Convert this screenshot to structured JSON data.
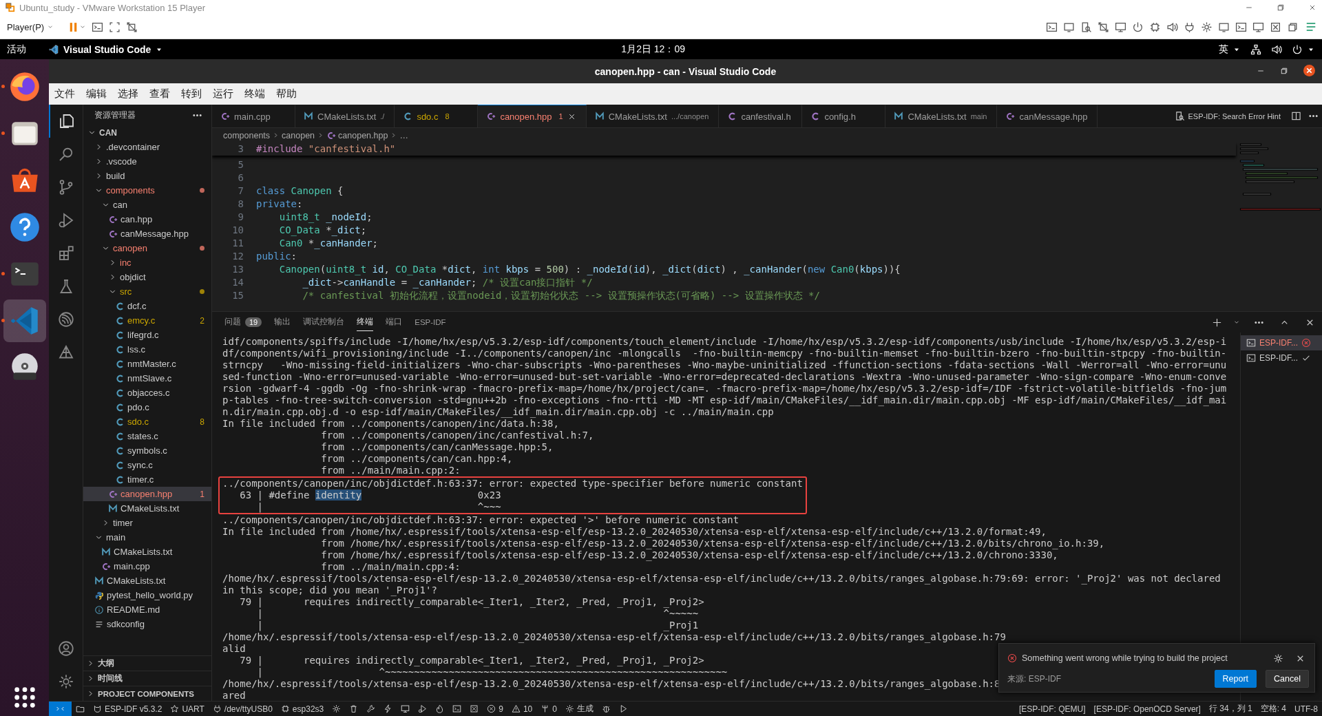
{
  "vm": {
    "title": "Ubuntu_study - VMware Workstation 15 Player",
    "player_menu": "Player(P)"
  },
  "topbar": {
    "activities": "活动",
    "app_menu": "Visual Studio Code",
    "clock": "1月2日  12：09",
    "input_method": "英"
  },
  "dock": [
    {
      "kind": "firefox",
      "running": true,
      "selected": false
    },
    {
      "kind": "files",
      "running": true,
      "selected": false
    },
    {
      "kind": "appstore",
      "running": false,
      "selected": false
    },
    {
      "kind": "help",
      "running": false,
      "selected": false
    },
    {
      "kind": "terminal",
      "running": true,
      "selected": false
    },
    {
      "kind": "vscode",
      "running": true,
      "selected": true
    },
    {
      "kind": "dvd",
      "running": false,
      "selected": false
    }
  ],
  "vscode": {
    "title": "canopen.hpp - can - Visual Studio Code",
    "menu": [
      "文件",
      "编辑",
      "选择",
      "查看",
      "转到",
      "运行",
      "终端",
      "帮助"
    ]
  },
  "activity_bar": [
    {
      "kind": "files",
      "selected": true
    },
    {
      "kind": "search",
      "selected": false
    },
    {
      "kind": "branch",
      "selected": false
    },
    {
      "kind": "debug",
      "selected": false
    },
    {
      "kind": "extensions",
      "selected": false
    },
    {
      "kind": "flask",
      "selected": false
    },
    {
      "kind": "esp",
      "selected": false
    },
    {
      "kind": "idf",
      "selected": false
    }
  ],
  "explorer": {
    "title": "资源管理器",
    "tree": [
      {
        "label": "CAN",
        "kind": "root",
        "expanded": true,
        "children": [
          {
            "label": ".devcontainer",
            "kind": "folder",
            "expanded": false
          },
          {
            "label": ".vscode",
            "kind": "folder",
            "expanded": false
          },
          {
            "label": "build",
            "kind": "folder",
            "expanded": false
          },
          {
            "label": "components",
            "kind": "folder",
            "expanded": true,
            "error": true,
            "children": [
              {
                "label": "can",
                "kind": "folder",
                "expanded": true,
                "children": [
                  {
                    "label": "can.hpp",
                    "kind": "cpp"
                  },
                  {
                    "label": "canMessage.hpp",
                    "kind": "cpp"
                  }
                ]
              },
              {
                "label": "canopen",
                "kind": "folder",
                "expanded": true,
                "error": true,
                "children": [
                  {
                    "label": "inc",
                    "kind": "folder",
                    "expanded": false,
                    "error": true
                  },
                  {
                    "label": "objdict",
                    "kind": "folder",
                    "expanded": false
                  },
                  {
                    "label": "src",
                    "kind": "folder",
                    "expanded": true,
                    "warning": true,
                    "children": [
                      {
                        "label": "dcf.c",
                        "kind": "c"
                      },
                      {
                        "label": "emcy.c",
                        "kind": "c",
                        "warning": true,
                        "badge": "2"
                      },
                      {
                        "label": "lifegrd.c",
                        "kind": "c"
                      },
                      {
                        "label": "lss.c",
                        "kind": "c"
                      },
                      {
                        "label": "nmtMaster.c",
                        "kind": "c"
                      },
                      {
                        "label": "nmtSlave.c",
                        "kind": "c"
                      },
                      {
                        "label": "objacces.c",
                        "kind": "c"
                      },
                      {
                        "label": "pdo.c",
                        "kind": "c"
                      },
                      {
                        "label": "sdo.c",
                        "kind": "c",
                        "warning": true,
                        "badge": "8"
                      },
                      {
                        "label": "states.c",
                        "kind": "c"
                      },
                      {
                        "label": "symbols.c",
                        "kind": "c"
                      },
                      {
                        "label": "sync.c",
                        "kind": "c"
                      },
                      {
                        "label": "timer.c",
                        "kind": "c"
                      }
                    ]
                  },
                  {
                    "label": "canopen.hpp",
                    "kind": "cpp",
                    "error": true,
                    "badge": "1",
                    "selected": true
                  },
                  {
                    "label": "CMakeLists.txt",
                    "kind": "cmake"
                  }
                ]
              },
              {
                "label": "timer",
                "kind": "folder",
                "expanded": false
              }
            ]
          },
          {
            "label": "main",
            "kind": "folder",
            "expanded": true,
            "children": [
              {
                "label": "CMakeLists.txt",
                "kind": "cmake"
              },
              {
                "label": "main.cpp",
                "kind": "cpp"
              }
            ]
          },
          {
            "label": "CMakeLists.txt",
            "kind": "cmake"
          },
          {
            "label": "pytest_hello_world.py",
            "kind": "py"
          },
          {
            "label": "README.md",
            "kind": "info"
          },
          {
            "label": "sdkconfig",
            "kind": "list"
          }
        ]
      }
    ],
    "sections": [
      "大纲",
      "时间线",
      "PROJECT COMPONENTS"
    ]
  },
  "tabs": [
    {
      "label": "main.cpp",
      "kind": "cpp",
      "selected": false
    },
    {
      "label": "CMakeLists.txt",
      "desc": "./",
      "kind": "cmake",
      "selected": false
    },
    {
      "label": "sdo.c",
      "kind": "c",
      "warning": true,
      "badge": "8",
      "selected": false
    },
    {
      "label": "canopen.hpp",
      "kind": "cpp",
      "error": true,
      "badge": "1",
      "selected": true
    },
    {
      "label": "CMakeLists.txt",
      "desc": ".../canopen",
      "kind": "cmake",
      "selected": false
    },
    {
      "label": "canfestival.h",
      "kind": "h",
      "selected": false
    },
    {
      "label": "config.h",
      "kind": "h",
      "selected": false
    },
    {
      "label": "CMakeLists.txt",
      "desc": "main",
      "kind": "cmake",
      "selected": false
    },
    {
      "label": "canMessage.hpp",
      "kind": "cpp",
      "selected": false
    }
  ],
  "tab_action": "ESP-IDF: Search Error Hint",
  "breadcrumb": [
    {
      "label": "components"
    },
    {
      "label": "canopen"
    },
    {
      "label": "canopen.hpp",
      "kind": "cpp"
    },
    {
      "label": "…"
    }
  ],
  "code": [
    {
      "n": "3",
      "sticky": true,
      "tokens": [
        {
          "text": "#include ",
          "kind": "directive"
        },
        {
          "text": "\"canfestival.h\"",
          "kind": "string"
        }
      ]
    },
    {
      "n": "5"
    },
    {
      "n": "6"
    },
    {
      "n": "7",
      "tokens": [
        {
          "text": "class ",
          "kind": "keyword"
        },
        {
          "text": "Canopen",
          "kind": "type"
        },
        {
          "text": " {",
          "kind": "plain"
        }
      ]
    },
    {
      "n": "8",
      "tokens": [
        {
          "text": "private",
          "kind": "keyword"
        },
        {
          "text": ":",
          "kind": "plain"
        }
      ]
    },
    {
      "n": "9",
      "tokens": [
        {
          "text": "    uint8_t",
          "kind": "type"
        },
        {
          "text": " _nodeId",
          "kind": "variable"
        },
        {
          "text": ";",
          "kind": "plain"
        }
      ]
    },
    {
      "n": "10",
      "tokens": [
        {
          "text": "    CO_Data",
          "kind": "type"
        },
        {
          "text": " *",
          "kind": "plain"
        },
        {
          "text": "_dict",
          "kind": "variable"
        },
        {
          "text": ";",
          "kind": "plain"
        }
      ]
    },
    {
      "n": "11",
      "tokens": [
        {
          "text": "    Can0",
          "kind": "type"
        },
        {
          "text": " *",
          "kind": "plain"
        },
        {
          "text": "_canHander",
          "kind": "variable"
        },
        {
          "text": ";",
          "kind": "plain"
        }
      ]
    },
    {
      "n": "12",
      "tokens": [
        {
          "text": "public",
          "kind": "keyword"
        },
        {
          "text": ":",
          "kind": "plain"
        }
      ]
    },
    {
      "n": "13",
      "tokens": [
        {
          "text": "    Canopen",
          "kind": "type"
        },
        {
          "text": "(",
          "kind": "plain"
        },
        {
          "text": "uint8_t",
          "kind": "type"
        },
        {
          "text": " id",
          "kind": "variable"
        },
        {
          "text": ", ",
          "kind": "plain"
        },
        {
          "text": "CO_Data",
          "kind": "type"
        },
        {
          "text": " *",
          "kind": "plain"
        },
        {
          "text": "dict",
          "kind": "variable"
        },
        {
          "text": ", ",
          "kind": "plain"
        },
        {
          "text": "int",
          "kind": "keyword"
        },
        {
          "text": " kbps",
          "kind": "variable"
        },
        {
          "text": " = ",
          "kind": "plain"
        },
        {
          "text": "500",
          "kind": "number"
        },
        {
          "text": ") : ",
          "kind": "plain"
        },
        {
          "text": "_nodeId",
          "kind": "variable"
        },
        {
          "text": "(",
          "kind": "plain"
        },
        {
          "text": "id",
          "kind": "variable"
        },
        {
          "text": "), ",
          "kind": "plain"
        },
        {
          "text": "_dict",
          "kind": "variable"
        },
        {
          "text": "(",
          "kind": "plain"
        },
        {
          "text": "dict",
          "kind": "variable"
        },
        {
          "text": ") , ",
          "kind": "plain"
        },
        {
          "text": "_canHander",
          "kind": "variable"
        },
        {
          "text": "(",
          "kind": "plain"
        },
        {
          "text": "new ",
          "kind": "keyword"
        },
        {
          "text": "Can0",
          "kind": "type"
        },
        {
          "text": "(",
          "kind": "plain"
        },
        {
          "text": "kbps",
          "kind": "variable"
        },
        {
          "text": ")){",
          "kind": "plain"
        }
      ]
    },
    {
      "n": "14",
      "tokens": [
        {
          "text": "        _dict",
          "kind": "variable"
        },
        {
          "text": "->",
          "kind": "plain"
        },
        {
          "text": "canHandle",
          "kind": "variable"
        },
        {
          "text": " = ",
          "kind": "plain"
        },
        {
          "text": "_canHander",
          "kind": "variable"
        },
        {
          "text": "; ",
          "kind": "plain"
        },
        {
          "text": "/* 设置can接口指针 */",
          "kind": "comment"
        }
      ]
    },
    {
      "n": "15",
      "tokens": [
        {
          "text": "        /* canfestival 初始化流程，设置nodeid，设置初始化状态 --> 设置预操作状态(可省略) --> 设置操作状态 */",
          "kind": "comment"
        }
      ]
    }
  ],
  "panel": {
    "tabs": [
      {
        "label": "问题",
        "badge": "19",
        "selected": false
      },
      {
        "label": "输出",
        "selected": false
      },
      {
        "label": "调试控制台",
        "selected": false
      },
      {
        "label": "终端",
        "selected": true
      },
      {
        "label": "端口",
        "selected": false
      },
      {
        "label": "ESP-IDF",
        "selected": false
      }
    ],
    "terminal": {
      "before": [
        "idf/components/spiffs/include -I/home/hx/esp/v5.3.2/esp-idf/components/touch_element/include -I/home/hx/esp/v5.3.2/esp-idf/components/usb/include -I/home/hx/esp/v5.3.2/esp-i",
        "df/components/wifi_provisioning/include -I../components/canopen/inc -mlongcalls  -fno-builtin-memcpy -fno-builtin-memset -fno-builtin-bzero -fno-builtin-stpcpy -fno-builtin-",
        "strncpy   -Wno-missing-field-initializers -Wno-char-subscripts -Wno-parentheses -Wno-maybe-uninitialized -ffunction-sections -fdata-sections -Wall -Werror=all -Wno-error=unu",
        "sed-function -Wno-error=unused-variable -Wno-error=unused-but-set-variable -Wno-error=deprecated-declarations -Wextra -Wno-unused-parameter -Wno-sign-compare -Wno-enum-conve",
        "rsion -gdwarf-4 -ggdb -Og -fno-shrink-wrap -fmacro-prefix-map=/home/hx/project/can=. -fmacro-prefix-map=/home/hx/esp/v5.3.2/esp-idf=/IDF -fstrict-volatile-bitfields -fno-jum",
        "p-tables -fno-tree-switch-conversion -std=gnu++2b -fno-exceptions -fno-rtti -MD -MT esp-idf/main/CMakeFiles/__idf_main.dir/main.cpp.obj -MF esp-idf/main/CMakeFiles/__idf_mai",
        "n.dir/main.cpp.obj.d -o esp-idf/main/CMakeFiles/__idf_main.dir/main.cpp.obj -c ../main/main.cpp",
        "In file included from ../components/canopen/inc/data.h:38,",
        "                 from ../components/canopen/inc/canfestival.h:7,",
        "                 from ../components/can/canMessage.hpp:5,",
        "                 from ../components/can/can.hpp:4,",
        "                 from ../main/main.cpp:2:"
      ],
      "boxed": [
        {
          "segments": [
            {
              "text": "../components/canopen/inc/objdictdef.h:63:37: error: expected type-specifier before numeric constant",
              "selected": false
            }
          ]
        },
        {
          "segments": [
            {
              "text": "   63 | #define ",
              "selected": false
            },
            {
              "text": "identity",
              "selected": true
            },
            {
              "text": "                    0x23",
              "selected": false
            }
          ]
        },
        {
          "segments": [
            {
              "text": "      |                                     ^~~~",
              "selected": false
            }
          ]
        }
      ],
      "after": [
        "../components/canopen/inc/objdictdef.h:63:37: error: expected '>' before numeric constant",
        "In file included from /home/hx/.espressif/tools/xtensa-esp-elf/esp-13.2.0_20240530/xtensa-esp-elf/xtensa-esp-elf/include/c++/13.2.0/format:49,",
        "                 from /home/hx/.espressif/tools/xtensa-esp-elf/esp-13.2.0_20240530/xtensa-esp-elf/xtensa-esp-elf/include/c++/13.2.0/bits/chrono_io.h:39,",
        "                 from /home/hx/.espressif/tools/xtensa-esp-elf/esp-13.2.0_20240530/xtensa-esp-elf/xtensa-esp-elf/include/c++/13.2.0/chrono:3330,",
        "                 from ../main/main.cpp:4:",
        "/home/hx/.espressif/tools/xtensa-esp-elf/esp-13.2.0_20240530/xtensa-esp-elf/xtensa-esp-elf/include/c++/13.2.0/bits/ranges_algobase.h:79:69: error: '_Proj2' was not declared",
        "in this scope; did you mean '_Proj1'?",
        "   79 |       requires indirectly_comparable<_Iter1, _Iter2, _Pred, _Proj1, _Proj2>",
        "      |                                                                     ^~~~~~",
        "      |                                                                     _Proj1",
        "/home/hx/.espressif/tools/xtensa-esp-elf/esp-13.2.0_20240530/xtensa-esp-elf/xtensa-esp-elf/include/c++/13.2.0/bits/ranges_algobase.h:79",
        "alid",
        "   79 |       requires indirectly_comparable<_Iter1, _Iter2, _Pred, _Proj1, _Proj2>",
        "      |                    ^~~~~~~~~~~~~~~~~~~~~~~~~~~~~~~~~~~~~~~~~~~~~~~~~~~~~~~~~~~~",
        "/home/hx/.espressif/tools/xtensa-esp-elf/esp-13.2.0_20240530/xtensa-esp-elf/xtensa-esp-elf/include/c++/13.2.0/bits/ranges_algobase.h:8",
        "ared"
      ]
    },
    "terminals": [
      {
        "label": "ESP-IDF...",
        "failed": true,
        "selected": true
      },
      {
        "label": "ESP-IDF...",
        "failed": false,
        "selected": false
      }
    ]
  },
  "notification": {
    "message": "Something went wrong while trying to build the project",
    "source": "来源: ESP-IDF",
    "buttons": [
      {
        "label": "Report",
        "primary": true
      },
      {
        "label": "Cancel",
        "primary": false
      }
    ]
  },
  "status_bar": {
    "left": [
      {
        "kind": "remote"
      },
      {
        "kind": "folder"
      },
      {
        "kind": "cat",
        "text": "ESP-IDF v5.3.2"
      },
      {
        "kind": "star",
        "text": "UART"
      },
      {
        "kind": "plug",
        "text": "/dev/ttyUSB0"
      },
      {
        "kind": "chip",
        "text": "esp32s3"
      },
      {
        "kind": "gear"
      },
      {
        "kind": "trash"
      },
      {
        "kind": "wrench"
      },
      {
        "kind": "bolt"
      },
      {
        "kind": "monitor"
      },
      {
        "kind": "debug"
      },
      {
        "kind": "flame"
      },
      {
        "kind": "console"
      },
      {
        "kind": "box"
      },
      {
        "kind": "error",
        "text": "9"
      },
      {
        "kind": "warning",
        "text": "10"
      },
      {
        "kind": "ports",
        "text": "0"
      },
      {
        "kind": "gear",
        "text": "生成"
      },
      {
        "kind": "bug"
      },
      {
        "kind": "play"
      }
    ],
    "right": [
      "[ESP-IDF: QEMU]",
      "[ESP-IDF: OpenOCD Server]",
      "行 34，列 1",
      "空格: 4",
      "UTF-8"
    ]
  }
}
